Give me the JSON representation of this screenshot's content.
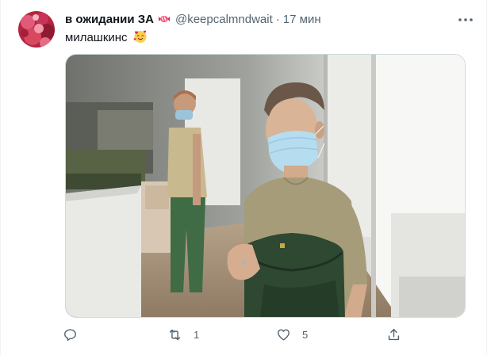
{
  "tweet": {
    "display_name": "в ожидании ЗА",
    "name_emoji": "candy-icon",
    "handle": "@keepcalmndwait",
    "separator": "·",
    "time": "17 мин",
    "text": "милашкинс",
    "text_emoji": "smiling-face-with-hearts-icon"
  },
  "actions": {
    "reply_count": "",
    "retweet_count": "1",
    "like_count": "5",
    "share_count": ""
  },
  "colors": {
    "text": "#0f1419",
    "secondary": "#536471",
    "border": "#cfd9de"
  }
}
